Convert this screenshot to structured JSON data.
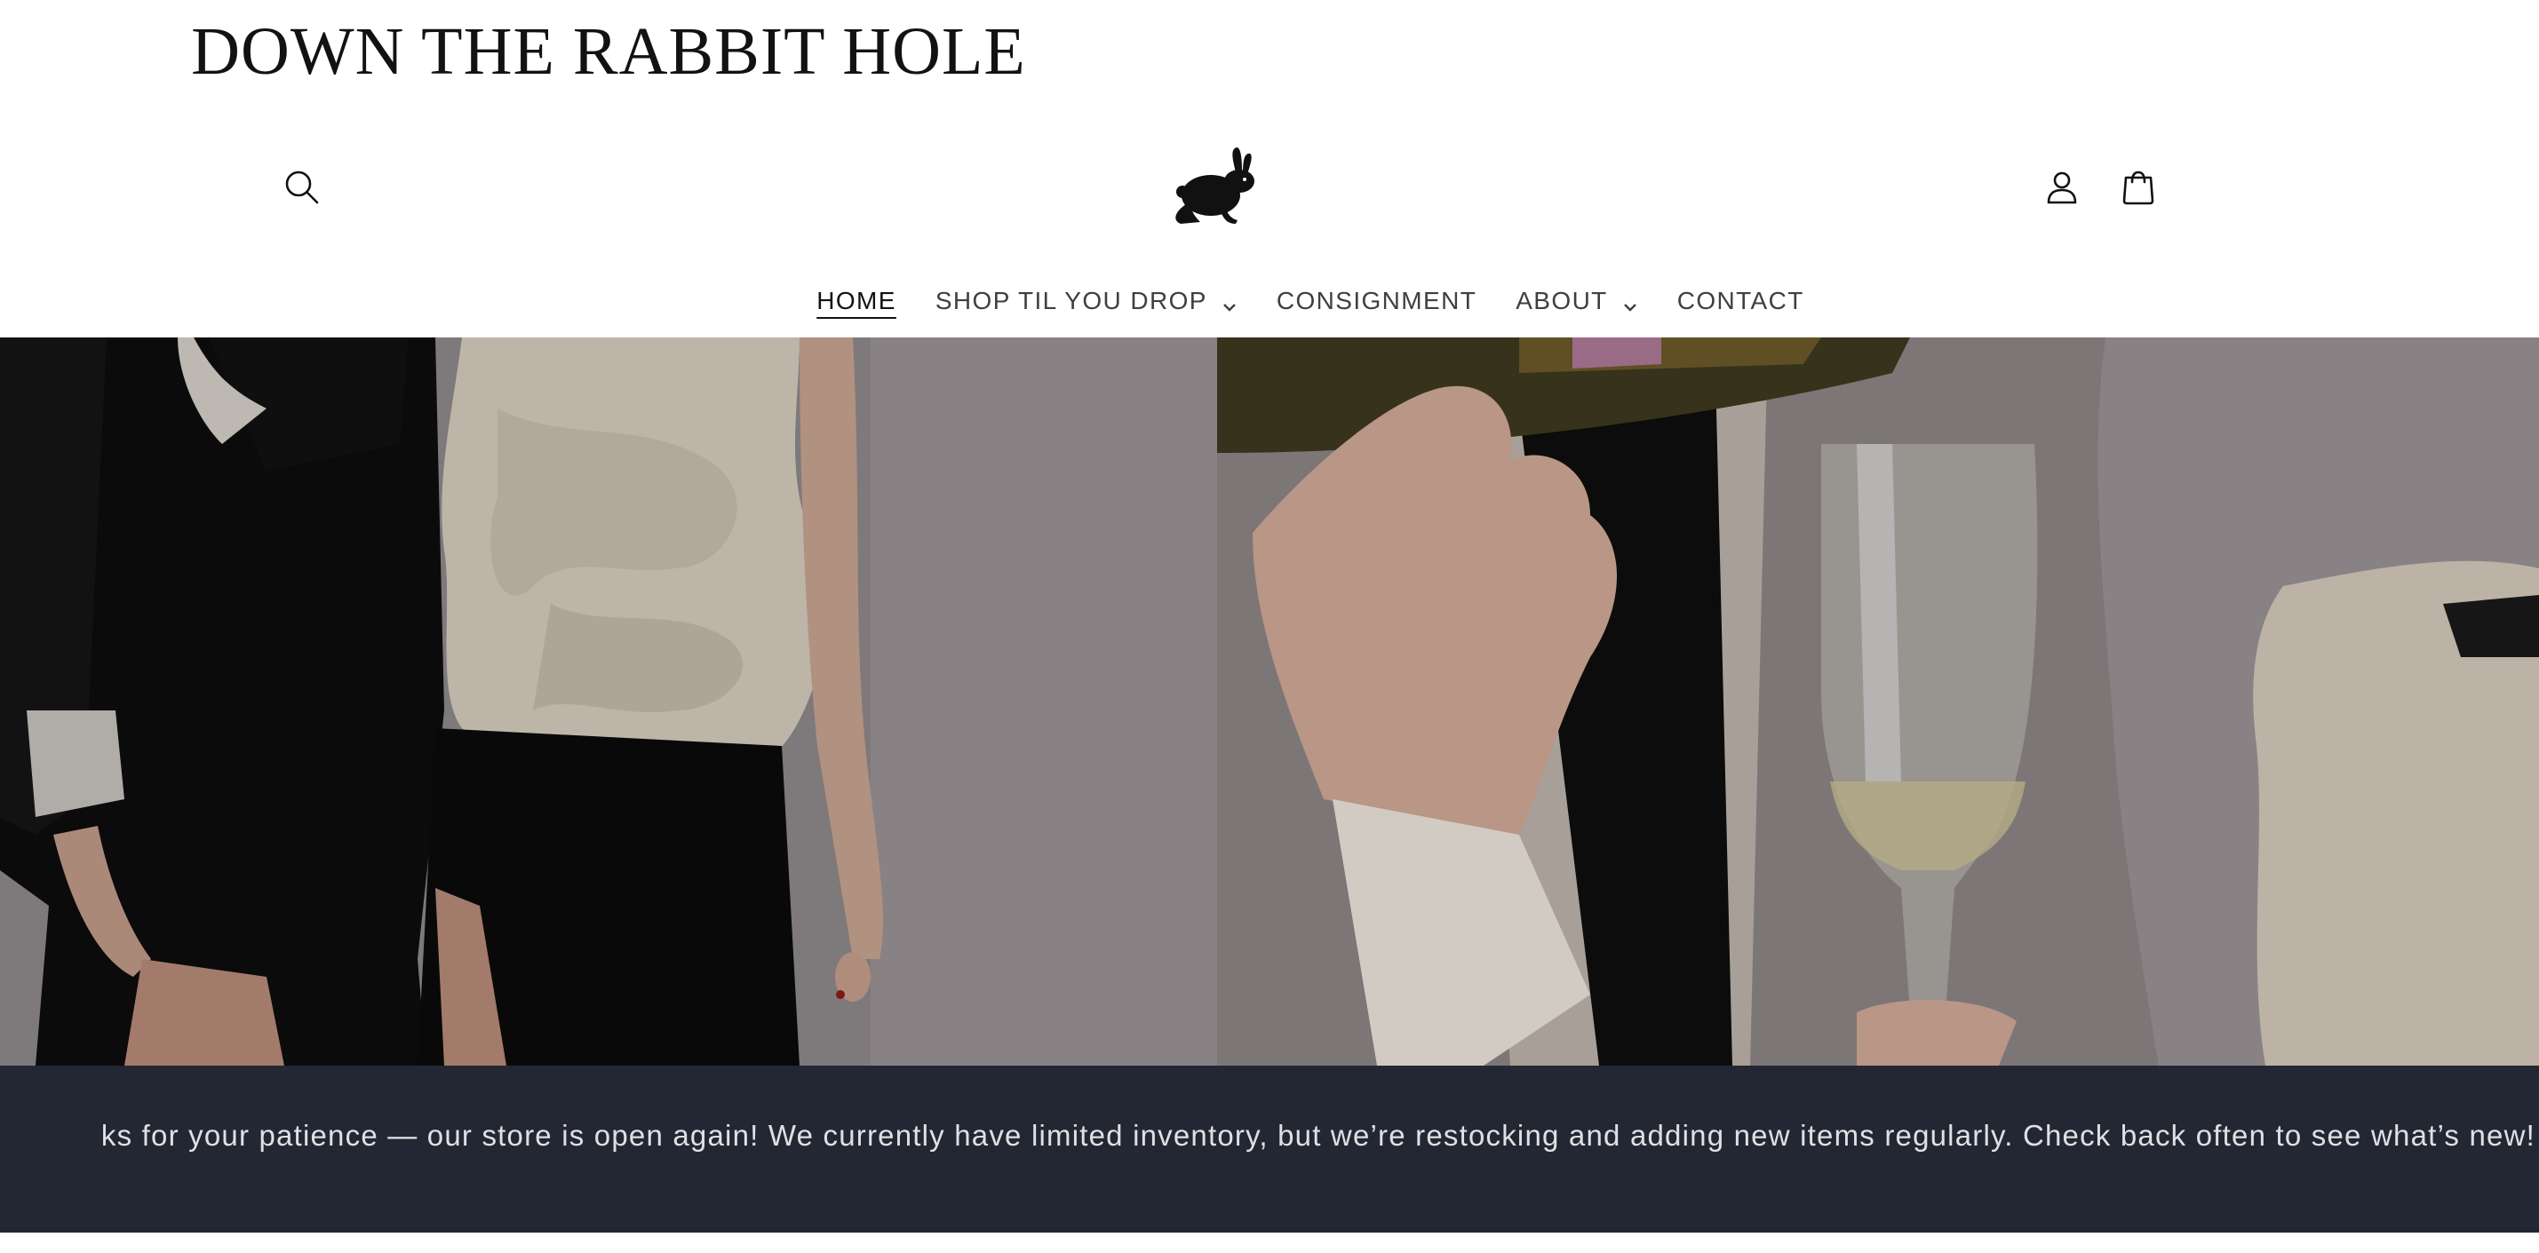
{
  "site": {
    "title": "DOWN THE RABBIT HOLE"
  },
  "header": {
    "search_icon": "search-icon",
    "logo_icon": "rabbit-logo",
    "account_icon": "account-icon",
    "cart_icon": "shopping-bag-icon"
  },
  "nav": {
    "items": [
      {
        "label": "HOME",
        "active": true,
        "has_dropdown": false
      },
      {
        "label": "SHOP TIL YOU DROP",
        "active": false,
        "has_dropdown": true
      },
      {
        "label": "CONSIGNMENT",
        "active": false,
        "has_dropdown": false
      },
      {
        "label": "ABOUT",
        "active": false,
        "has_dropdown": true
      },
      {
        "label": "CONTACT",
        "active": false,
        "has_dropdown": false
      }
    ]
  },
  "announcement": {
    "text": "ks for your patience — our store is open again! We currently have limited inventory, but we’re restocking and adding new items regularly. Check back often to see what’s new!"
  },
  "colors": {
    "announcement_bg": "#232733",
    "announcement_text": "#dfe0e4",
    "text_primary": "#121212"
  }
}
